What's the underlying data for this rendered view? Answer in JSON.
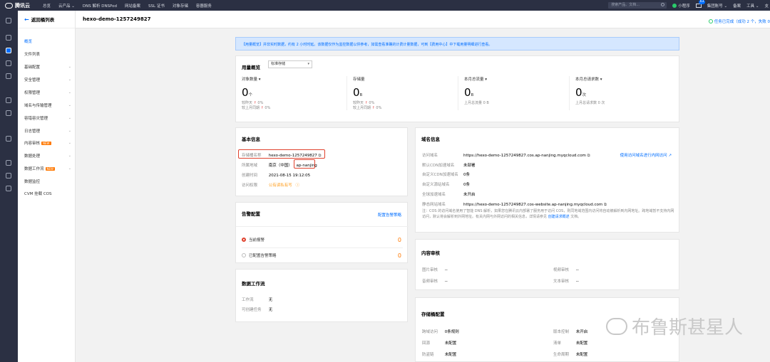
{
  "topbar": {
    "brand": "腾讯云",
    "nav": [
      "总览",
      "云产品 ⌄",
      "DNS 解析 DNSPod",
      "网站备案",
      "SSL 证书",
      "对象存储",
      "容器服务"
    ],
    "search_placeholder": "搜索产品、文档...",
    "mini_program": "小程序",
    "mail_badge": "63",
    "account": "集团账号 ⌄",
    "filing": "备案",
    "tools": "工具 ⌄",
    "support": "支"
  },
  "leftnav": {
    "back_label": "返回桶列表",
    "items": [
      {
        "label": "概览",
        "active": true,
        "chevron": false,
        "new": false
      },
      {
        "label": "文件列表",
        "active": false,
        "chevron": false,
        "new": false
      },
      {
        "label": "基础配置",
        "active": false,
        "chevron": true,
        "new": false
      },
      {
        "label": "安全管理",
        "active": false,
        "chevron": true,
        "new": false
      },
      {
        "label": "权限管理",
        "active": false,
        "chevron": true,
        "new": false
      },
      {
        "label": "域名与传输管理",
        "active": false,
        "chevron": true,
        "new": false
      },
      {
        "label": "容错容灾管理",
        "active": false,
        "chevron": true,
        "new": false
      },
      {
        "label": "日志管理",
        "active": false,
        "chevron": true,
        "new": false
      },
      {
        "label": "内容审核",
        "active": false,
        "chevron": true,
        "new": true
      },
      {
        "label": "数据处理",
        "active": false,
        "chevron": true,
        "new": false
      },
      {
        "label": "数据工作流",
        "active": false,
        "chevron": true,
        "new": true
      },
      {
        "label": "数据监控",
        "active": false,
        "chevron": false,
        "new": false
      },
      {
        "label": "CVM 挂载 COS",
        "active": false,
        "chevron": false,
        "new": false
      }
    ],
    "new_badge": "NEW"
  },
  "header": {
    "bucket_name": "hexo-demo-1257249827",
    "task_status": "任务已完成（成功 2 个，失败 0"
  },
  "notice": "【用量概览】并非实时数据，约有 2 小时时延。该数据仅作为监控数据以供参考，如需查看准确的计费计量数据，可到【费用中心】中下载用量明细进行查看。",
  "usage": {
    "title": "用量概览",
    "storage_select": "标准存储",
    "stats": [
      {
        "label": "对象数量",
        "dropdown": true,
        "value": "0",
        "unit": "个",
        "sub1_label": "较昨天",
        "sub1_value": "0%",
        "sub1_up": true,
        "sub2_label": "较上月同期",
        "sub2_value": "0%",
        "sub2_up": true
      },
      {
        "label": "存储量",
        "dropdown": false,
        "value": "0",
        "unit": "B",
        "sub1_label": "较昨天",
        "sub1_value": "0%",
        "sub1_up": true,
        "sub2_label": "较上月同期",
        "sub2_value": "0%",
        "sub2_up": true
      },
      {
        "label": "本月总流量",
        "dropdown": true,
        "value": "0",
        "unit": "B",
        "sub1_label": "上月总流量 0 B",
        "sub1_value": "",
        "sub1_up": false,
        "sub2_label": "",
        "sub2_value": "",
        "sub2_up": false
      },
      {
        "label": "本月总请求数",
        "dropdown": true,
        "value": "0",
        "unit": "次",
        "sub1_label": "上月总请求数 0 次",
        "sub1_value": "",
        "sub1_up": false,
        "sub2_label": "",
        "sub2_value": "",
        "sub2_up": false
      }
    ]
  },
  "basic": {
    "title": "基本信息",
    "rows": [
      {
        "k": "存储桶名称",
        "v": "hexo-demo-1257249827"
      },
      {
        "k": "所属地域",
        "v": "南京（中国）",
        "tag": "ap-nanjing"
      },
      {
        "k": "创建时间",
        "v": "2021-08-15 19:12:05"
      },
      {
        "k": "访问权限",
        "v": "公有读私有写"
      }
    ]
  },
  "alarm": {
    "title": "告警配置",
    "link": "配置告警策略",
    "rows": [
      {
        "label": "当前报警",
        "count": "0"
      },
      {
        "label": "已配置告警策略",
        "count": "0"
      }
    ]
  },
  "workflow": {
    "title": "数据工作流",
    "rows": [
      {
        "k": "工作流",
        "v": "无"
      },
      {
        "k": "可创建任务",
        "v": "无"
      }
    ]
  },
  "domain": {
    "title": "域名信息",
    "link": "使用访问域名进行内网访问",
    "rows": [
      {
        "k": "访问域名",
        "v": "https://hexo-demo-1257249827.cos.ap-nanjing.myqcloud.com"
      },
      {
        "k": "默认CDN加速域名",
        "v": "未部署"
      },
      {
        "k": "自定义CDN加速域名",
        "v": "0条"
      },
      {
        "k": "自定义源站域名",
        "v": "0条"
      },
      {
        "k": "全球加速域名",
        "v": "未开启"
      },
      {
        "k": "静态网站域名",
        "v": "https://hexo-demo-1257249827.cos-website.ap-nanjing.myqcloud.com"
      }
    ],
    "note": "注：COS 的访问域名使用了智能 DNS 解析，如果您在腾讯云内部署了服务用于访问 COS，则同地域范围内访问将自动被解析到内网地址。跨地域暂不支持内网访问，默认将会解析到外网地址。有关内网与外网访问的相关信息，详情请参见",
    "note_link": "创建请求概述",
    "note_tail": " 文档。"
  },
  "audit": {
    "title": "内容审核",
    "rows": [
      {
        "k": "图片审核",
        "v": "--"
      },
      {
        "k": "视频审核",
        "v": "--"
      },
      {
        "k": "音频审核",
        "v": "--"
      },
      {
        "k": "文本审核",
        "v": "--"
      }
    ]
  },
  "bucketcfg": {
    "title": "存储桶配置",
    "rows": [
      {
        "k": "跨域访问",
        "v": "0条规则"
      },
      {
        "k": "版本控制",
        "v": "未开启"
      },
      {
        "k": "回源",
        "v": "未配置"
      },
      {
        "k": "清单",
        "v": "未配置"
      },
      {
        "k": "防盗链",
        "v": "未配置"
      },
      {
        "k": "生命周期",
        "v": "未配置"
      }
    ]
  },
  "watermark": "布鲁斯甚星人",
  "colors": {
    "primary": "#006eff",
    "alert": "#e0422e",
    "warning": "#ff7800",
    "success": "#29cc6a"
  }
}
